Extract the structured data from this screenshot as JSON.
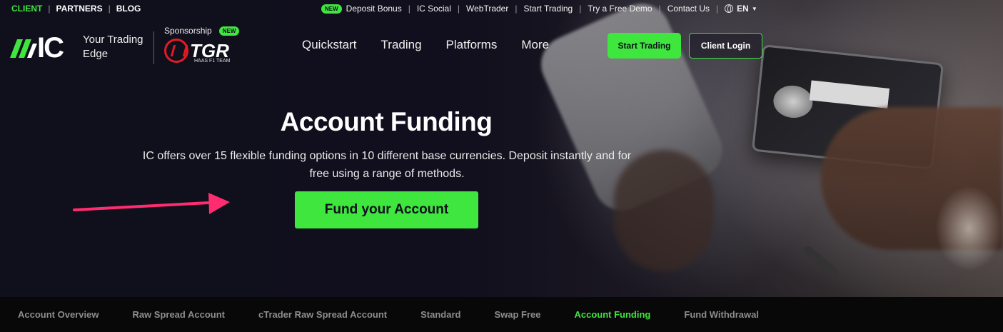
{
  "utility_bar": {
    "left_links": [
      "CLIENT",
      "PARTNERS",
      "BLOG"
    ],
    "active_left": "CLIENT",
    "new_badge": "NEW",
    "right_links": [
      "Deposit Bonus",
      "IC Social",
      "WebTrader",
      "Start Trading",
      "Try a Free Demo",
      "Contact Us"
    ],
    "language": "EN"
  },
  "header": {
    "logo_text": "IC",
    "tagline": "Your Trading Edge",
    "sponsorship_label": "Sponsorship",
    "sponsorship_badge": "NEW",
    "sponsor_name": "TGR",
    "sponsor_sub": "HAAS F1 TEAM",
    "nav": [
      "Quickstart",
      "Trading",
      "Platforms",
      "More"
    ],
    "start_trading": "Start Trading",
    "client_login": "Client Login"
  },
  "hero": {
    "title": "Account Funding",
    "description": "IC offers over 15 flexible funding options in 10 different base currencies. Deposit instantly and for free using a range of methods.",
    "cta": "Fund your Account"
  },
  "subnav": {
    "items": [
      "Account Overview",
      "Raw Spread Account",
      "cTrader Raw Spread Account",
      "Standard",
      "Swap Free",
      "Account Funding",
      "Fund Withdrawal"
    ],
    "active": "Account Funding"
  },
  "colors": {
    "accent": "#3ee63e",
    "background": "#0f0e1a",
    "annotation_arrow": "#ff2d6f"
  }
}
